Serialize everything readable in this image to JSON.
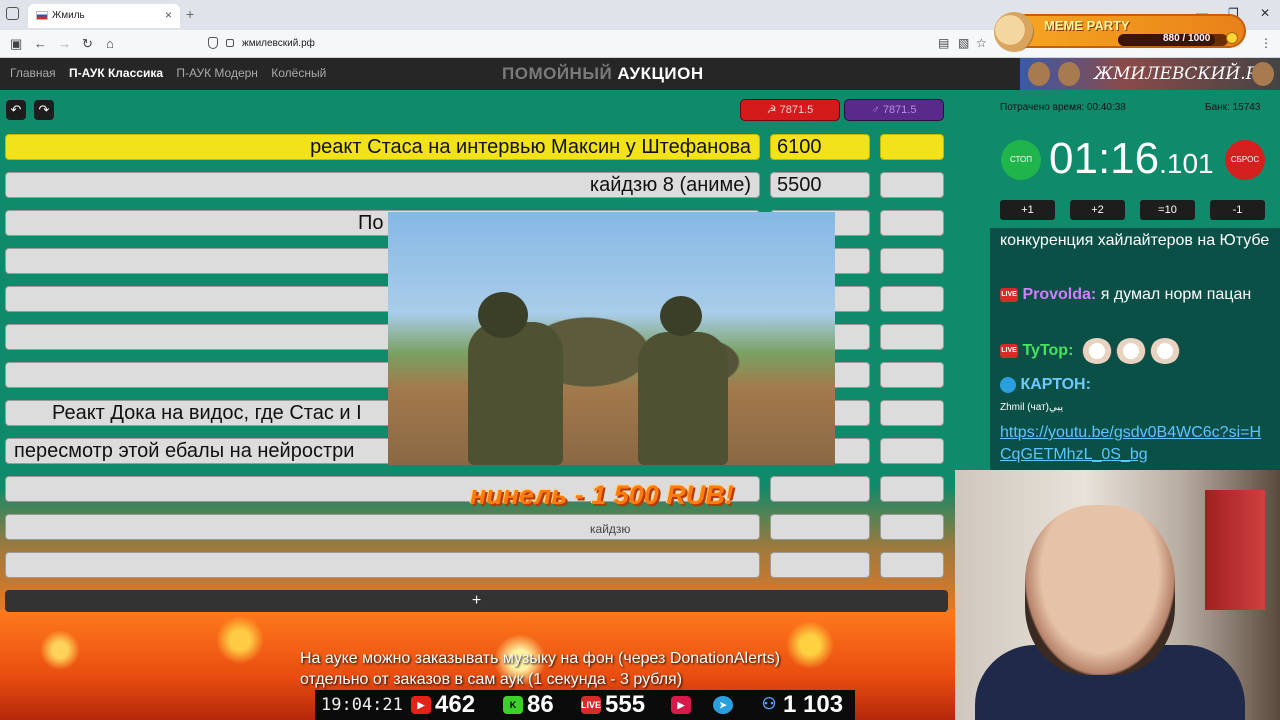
{
  "browser": {
    "tab_title": "Жмиль",
    "tab_close": "×",
    "new_tab": "+",
    "url": "жмилевский.рф"
  },
  "meme_party": {
    "title": "MEME PARTY",
    "count": "880 / 1000",
    "progress": 0.88
  },
  "site": {
    "nav": [
      "Главная",
      "П-АУК Классика",
      "П-АУК Модерн",
      "Колёсный"
    ],
    "active_nav": "П-АУК Классика",
    "title_part1": "ПОМОЙНЫЙ",
    "title_part2": "АУКЦИОН",
    "banner_text": "ЖМИЛЕВСКИЙ.РФ"
  },
  "auction": {
    "undo": "↶",
    "redo": "↷",
    "timer_red": "☭ 7871.5",
    "timer_purple": "♂ 7871.5",
    "rows": [
      {
        "title": "реакт Стаса на интервью Максин у Штефанова",
        "amount": "6100",
        "plus": "+"
      },
      {
        "title": "кайдзю 8 (аниме)",
        "amount": "5500",
        "plus": "+"
      },
      {
        "title": "По",
        "amount": "",
        "plus": "+"
      },
      {
        "title": "",
        "amount": "",
        "plus": "+"
      },
      {
        "title": "",
        "amount": "",
        "plus": "+"
      },
      {
        "title": "",
        "amount": "",
        "plus": "+"
      },
      {
        "title": "",
        "amount": "",
        "plus": "+"
      },
      {
        "title": "Реакт Дока на видос, где Стас и I",
        "amount": "",
        "plus": "+"
      },
      {
        "title": "пересмотр этой ебалы на нейростри",
        "amount": "",
        "plus": "+"
      },
      {
        "title": "",
        "amount": "",
        "plus": ""
      },
      {
        "title": "",
        "amount": "",
        "plus": ""
      },
      {
        "title": "",
        "amount": "",
        "plus": ""
      }
    ],
    "add_row": "+",
    "donation": "нинель - 1 500 RUB!",
    "donation_sub": "кайдзю",
    "music_note_line1": "На ауке можно заказывать музыку на фон (через DonationAlerts)",
    "music_note_line2": "отдельно от заказов в сам аук (1 секунда - 3 рубля)"
  },
  "stats": {
    "time": "19:04:21",
    "youtube": "462",
    "kick": "86",
    "vk": "555",
    "total": "1 103",
    "live_label": "LIVE"
  },
  "panel": {
    "spent": "Потрачено время: 00:40:38",
    "bank": "Банк: 15743",
    "stop": "СТОП",
    "reset": "СБРОС",
    "timer_main": "01:16",
    "timer_ms": ".101",
    "increments": [
      "+1",
      "+2",
      "=10",
      "-1"
    ]
  },
  "chat": {
    "msg1": "конкуренция хайлайтеров на Ютубе",
    "user2": "Provolda:",
    "msg2": "я думал норм пацан",
    "user3": "TyTop:",
    "user4": "КАРТОН:",
    "sub4": "Zhmil (чат)يبي",
    "link": "https://youtu.be/gsdv0B4WC6c?si=HCqGETMhzL_0S_bg",
    "live_label": "LIVE"
  },
  "colors": {
    "auction_bg": "#0f8a6a",
    "highlight_row": "#f1e21a",
    "timer_red": "#d41a1a",
    "timer_purple": "#5a2a8a"
  }
}
